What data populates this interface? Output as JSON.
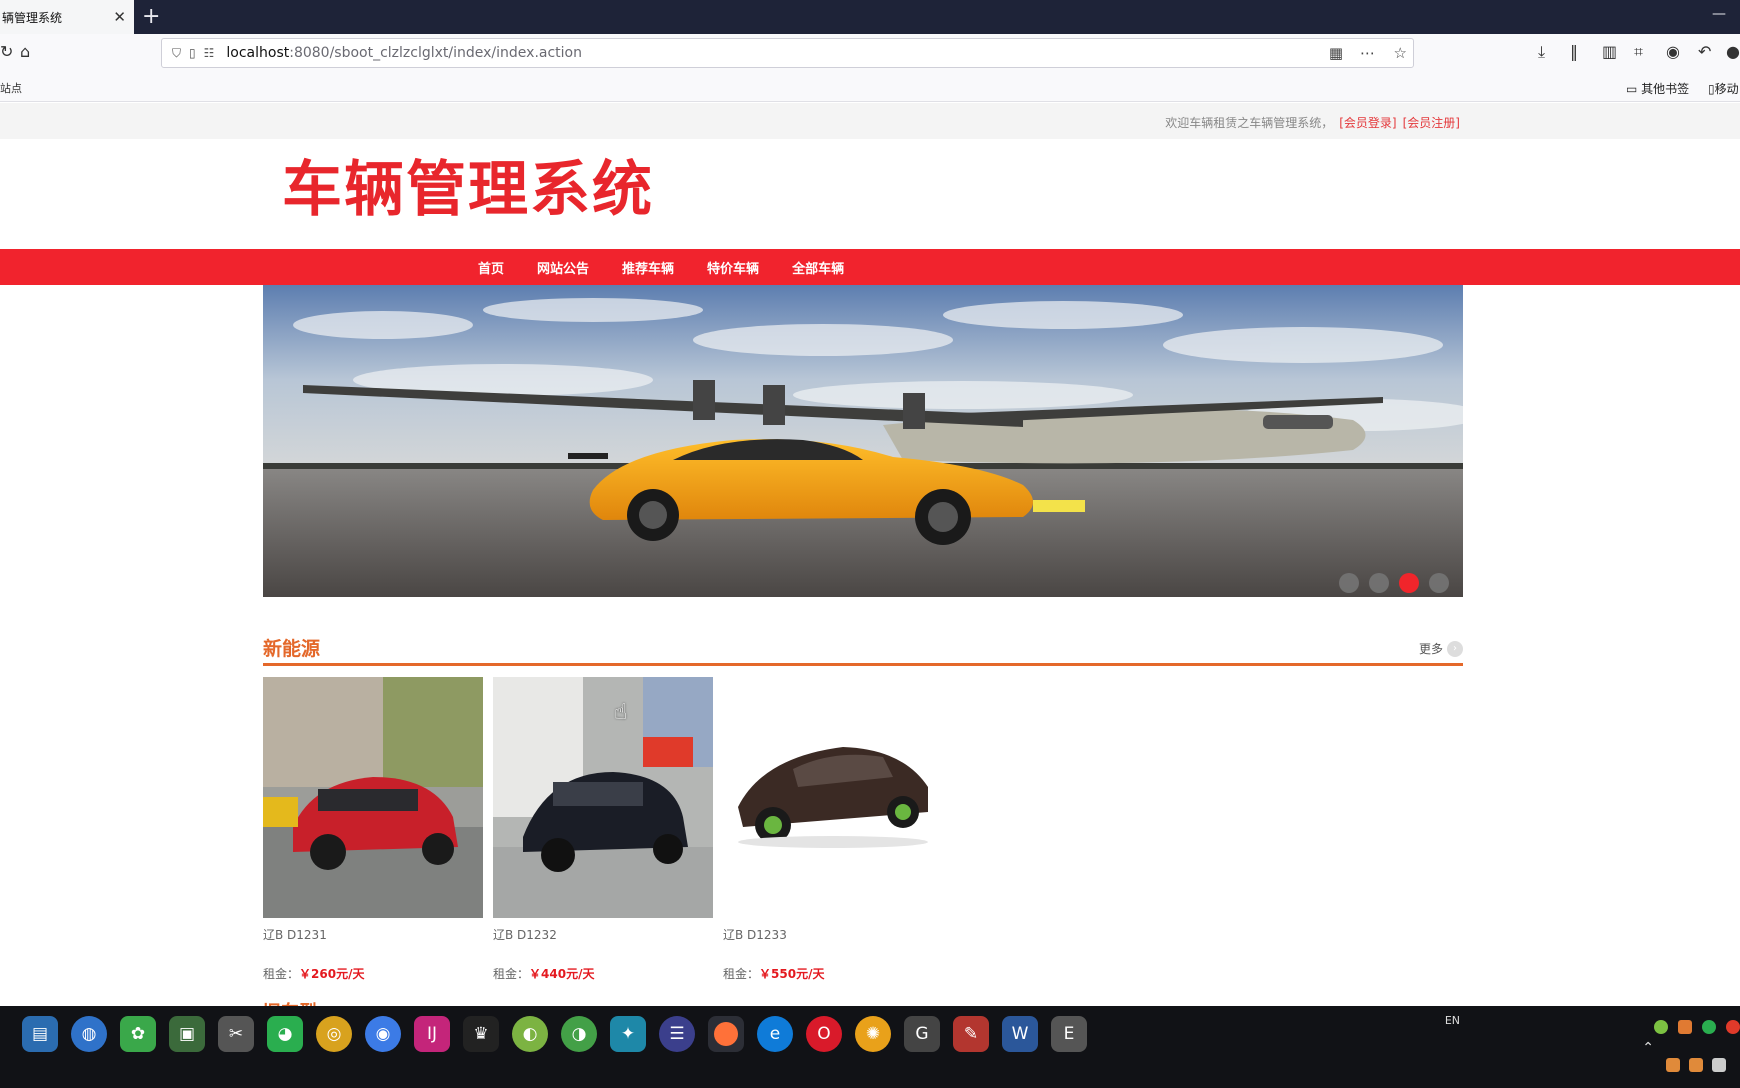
{
  "browser": {
    "tab_title": "辆管理系统",
    "tab_close": "✕",
    "new_tab": "+",
    "minimize": "—",
    "url_host": "localhost",
    "url_path": ":8080/sboot_clzlzclglxt/index/index.action",
    "bookmarks_left": "站点",
    "bookmark_other": "其他书签",
    "bookmark_mobile": "移动"
  },
  "header": {
    "welcome_text": "欢迎车辆租赁之车辆管理系统，",
    "login_link": "[会员登录]",
    "register_link": "[会员注册]",
    "logo_text": "车辆管理系统"
  },
  "nav": {
    "items": [
      {
        "label": "首页"
      },
      {
        "label": "网站公告"
      },
      {
        "label": "推荐车辆"
      },
      {
        "label": "特价车辆"
      },
      {
        "label": "全部车辆"
      }
    ]
  },
  "banner": {
    "slide_count": 4,
    "active_slide": 3,
    "colors": {
      "car": "#f5a014",
      "sky": "#7d9ac2",
      "ground": "#6f6b68"
    }
  },
  "section": {
    "title": "新能源",
    "more_label": "更多",
    "rent_label": "租金："
  },
  "cars": [
    {
      "plate": "辽B D1231",
      "price": "￥260元/天",
      "color": "#c8202a"
    },
    {
      "plate": "辽B D1232",
      "price": "￥440元/天",
      "color": "#1a1d26"
    },
    {
      "plate": "辽B D1233",
      "price": "￥550元/天",
      "color": "#3b2a24"
    }
  ],
  "next_section_title": "旧车型",
  "taskbar": {
    "lang": "EN"
  },
  "colors": {
    "brand_red": "#f1232d",
    "section_orange": "#e4682a",
    "price_red": "#e4191f"
  }
}
